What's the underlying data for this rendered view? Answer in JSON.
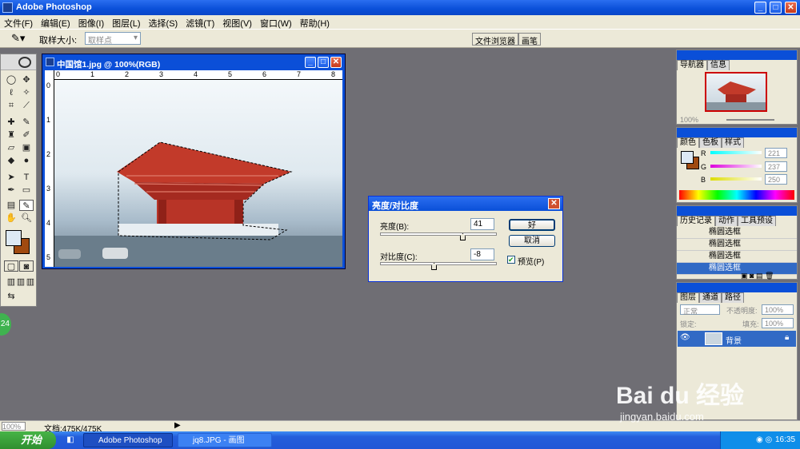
{
  "app": {
    "title": "Adobe Photoshop"
  },
  "menu": [
    "文件(F)",
    "编辑(E)",
    "图像(I)",
    "图层(L)",
    "选择(S)",
    "滤镜(T)",
    "视图(V)",
    "窗口(W)",
    "帮助(H)"
  ],
  "options": {
    "sample_size_label": "取样大小:",
    "sample_size_value": "取样点"
  },
  "well_tabs": [
    "文件浏览器",
    "画笔"
  ],
  "document": {
    "title": "中国馆1.jpg @ 100%(RGB)",
    "ruler_ticks": [
      "0",
      "1",
      "2",
      "3",
      "4",
      "5",
      "6",
      "7",
      "8"
    ],
    "v_ruler_ticks": [
      "0",
      "1",
      "2",
      "3",
      "4",
      "5"
    ]
  },
  "dialog": {
    "title": "亮度/对比度",
    "brightness_label": "亮度(B):",
    "brightness_value": "41",
    "brightness": 41,
    "contrast_label": "对比度(C):",
    "contrast_value": "-8",
    "contrast": -8,
    "ok_label": "好",
    "cancel_label": "取消",
    "preview_label": "预览(P)",
    "preview_checked": true
  },
  "navigator": {
    "tabs": [
      "导航器",
      "信息"
    ],
    "zoom": "100%"
  },
  "color_panel": {
    "tabs": [
      "颜色",
      "色板",
      "样式"
    ],
    "r_label": "R",
    "g_label": "G",
    "b_label": "B",
    "r": "221",
    "g": "237",
    "b": "250",
    "fg": "#dde9f4",
    "bg": "#a04a10"
  },
  "history": {
    "tabs": [
      "历史记录",
      "动作",
      "工具预设"
    ],
    "items": [
      "椭圆选框",
      "椭圆选框",
      "椭圆选框",
      "椭圆选框"
    ]
  },
  "layers": {
    "tabs": [
      "图层",
      "通道",
      "路径"
    ],
    "blend_mode": "正常",
    "opacity_label": "不透明度:",
    "opacity": "100%",
    "lock_label": "锁定:",
    "fill_label": "填充:",
    "fill": "100%",
    "layer_name": "背景"
  },
  "status": {
    "zoom": "100%",
    "doc_size": "文档:475K/475K"
  },
  "taskbar": {
    "start": "开始",
    "tasks": [
      "Adobe Photoshop",
      "jq8.JPG - 画图"
    ],
    "time": "16:35"
  },
  "watermark": {
    "brand": "Bai du 经验",
    "url": "jingyan.baidu.com"
  },
  "badge": "24"
}
